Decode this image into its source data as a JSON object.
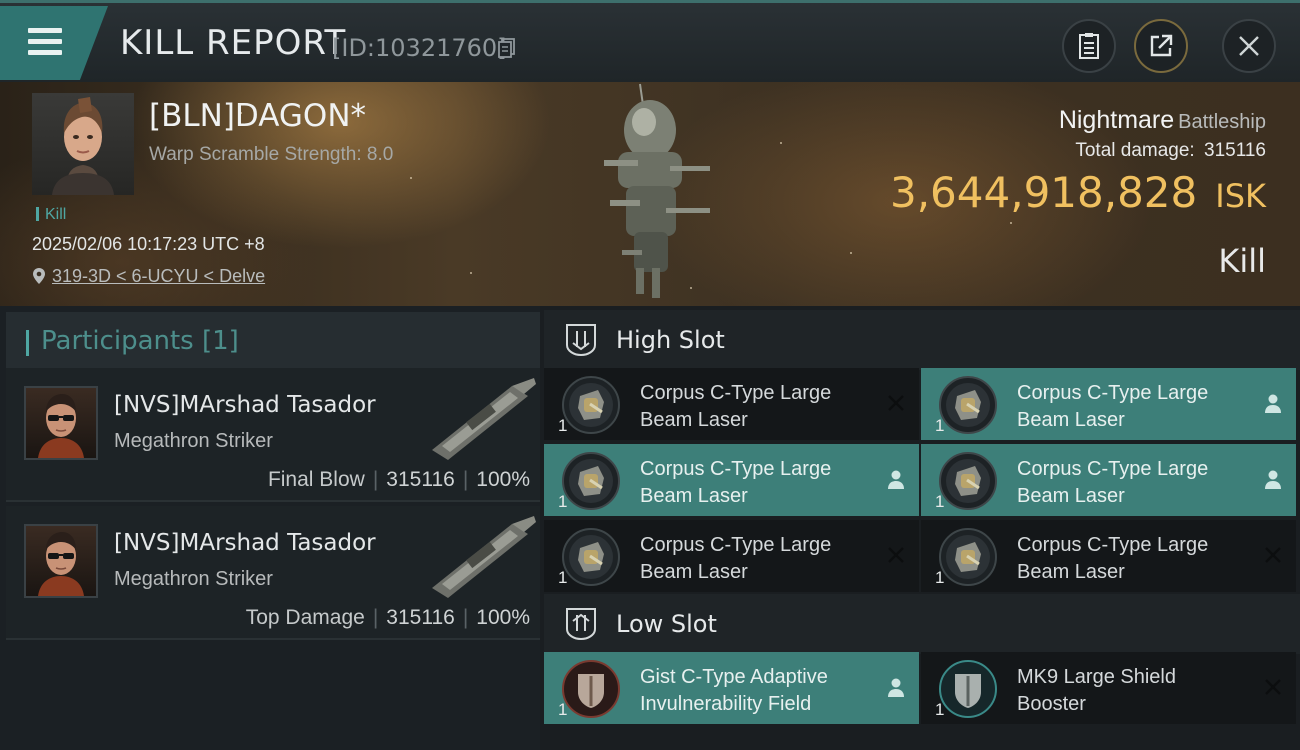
{
  "header": {
    "title": "KILL REPORT",
    "id_text": "[ID:10321760]"
  },
  "victim": {
    "name": "[BLN]DAGON*",
    "warp_text": "Warp Scramble Strength: 8.0",
    "kill_tag": "Kill",
    "datetime": "2025/02/06 10:17:23 UTC +8",
    "location": "319-3D < 6-UCYU < Delve"
  },
  "ship": {
    "name": "Nightmare",
    "class": "Battleship",
    "total_damage_label": "Total damage:",
    "total_damage": "315116",
    "isk_value": "3,644,918,828",
    "isk_unit": "ISK",
    "result": "Kill"
  },
  "participants": {
    "title": "Participants",
    "count": "[1]",
    "list": [
      {
        "name": "[NVS]MArshad Tasador",
        "ship": "Megathron Striker",
        "role": "Final Blow",
        "damage": "315116",
        "percent": "100%"
      },
      {
        "name": "[NVS]MArshad Tasador",
        "ship": "Megathron Striker",
        "role": "Top Damage",
        "damage": "315116",
        "percent": "100%"
      }
    ]
  },
  "fitting": {
    "high_slot": {
      "title": "High Slot",
      "modules": [
        {
          "name": "Corpus C-Type Large Beam Laser",
          "qty": "1",
          "status": "destroyed",
          "active": false
        },
        {
          "name": "Corpus C-Type Large Beam Laser",
          "qty": "1",
          "status": "dropped",
          "active": true
        },
        {
          "name": "Corpus C-Type Large Beam Laser",
          "qty": "1",
          "status": "dropped",
          "active": true
        },
        {
          "name": "Corpus C-Type Large Beam Laser",
          "qty": "1",
          "status": "dropped",
          "active": true
        },
        {
          "name": "Corpus C-Type Large Beam Laser",
          "qty": "1",
          "status": "destroyed",
          "active": false
        },
        {
          "name": "Corpus C-Type Large Beam Laser",
          "qty": "1",
          "status": "destroyed",
          "active": false
        }
      ]
    },
    "low_slot": {
      "title": "Low Slot",
      "modules": [
        {
          "name": "Gist C-Type Adaptive Invulnerability Field",
          "qty": "1",
          "status": "dropped",
          "active": true
        },
        {
          "name": "MK9 Large Shield Booster",
          "qty": "1",
          "status": "destroyed",
          "active": false
        }
      ]
    }
  },
  "colors": {
    "accent_teal": "#3d7f79",
    "isk_gold": "#f0c060",
    "menu_teal": "#2f7471"
  },
  "icons": [
    "menu-icon",
    "copy-icon",
    "clipboard-icon",
    "share-icon",
    "close-icon",
    "location-pin-icon",
    "slot-icon",
    "person-icon",
    "x-icon"
  ]
}
